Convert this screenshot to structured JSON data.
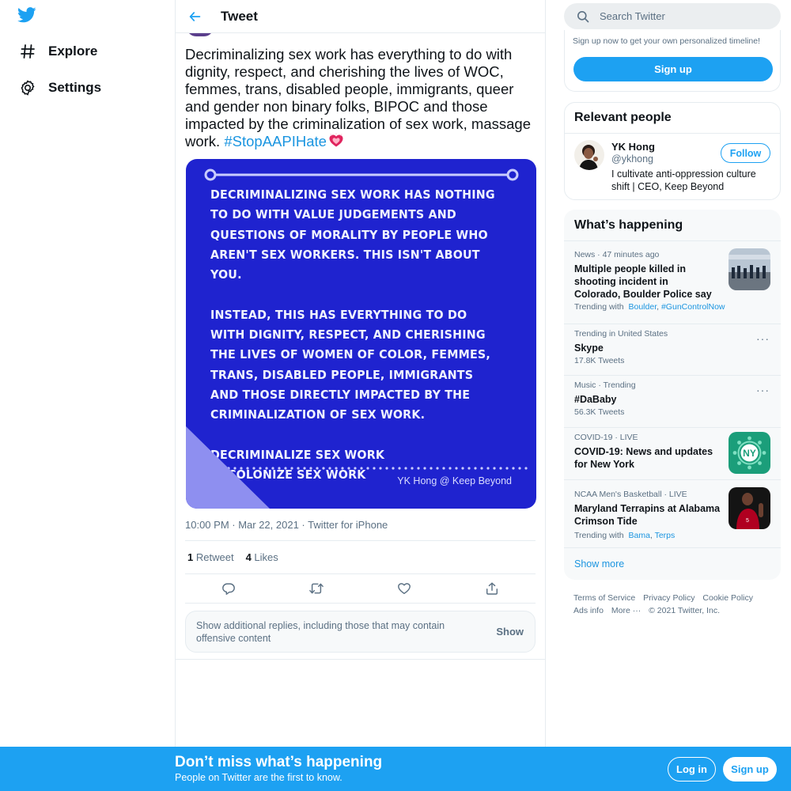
{
  "nav": {
    "logo_icon": "twitter-bird-icon",
    "items": [
      {
        "label": "Explore",
        "icon": "hashtag-icon"
      },
      {
        "label": "Settings",
        "icon": "gear-icon"
      }
    ]
  },
  "header": {
    "title": "Tweet",
    "back_icon": "arrow-left-icon"
  },
  "tweet": {
    "text": "Decriminalizing sex work has everything to do with dignity, respect, and cherishing the lives of WOC, femmes, trans, disabled people, immigrants, queer and gender non binary folks, BIPOC and those impacted by the criminalization of sex work, massage work.",
    "hashtag": "#StopAAPIHate",
    "emoji": "heart-emoji",
    "image": {
      "text": "Decriminalizing sex work has nothing to do with value judgements and questions of morality by people who aren't sex workers. This isn't about you.\n\nInstead, this has everything to do with dignity, respect, and cherishing the lives of Women of Color, femmes, trans, disabled people, immigrants and those directly impacted by the criminalization of sex work.\n\nDecriminalize sex work\nDecolonize sex work",
      "credit": "YK Hong @ Keep Beyond",
      "background": "#1f23cf"
    },
    "meta": "10:00 PM · Mar 22, 2021 · Twitter for iPhone",
    "retweets": {
      "count": "1",
      "label": "Retweet"
    },
    "likes": {
      "count": "4",
      "label": "Likes"
    },
    "actions": [
      "reply-icon",
      "retweet-icon",
      "like-icon",
      "share-icon"
    ]
  },
  "replies_notice": {
    "message": "Show additional replies, including those that may contain offensive content",
    "button": "Show"
  },
  "search": {
    "placeholder": "Search Twitter"
  },
  "signup_card": {
    "text": "Sign up now to get your own personalized timeline!",
    "button": "Sign up"
  },
  "relevant": {
    "title": "Relevant people",
    "person": {
      "name": "YK Hong",
      "handle": "@ykhong",
      "bio": "I cultivate anti-oppression culture shift | CEO, Keep Beyond",
      "follow": "Follow"
    }
  },
  "trends": {
    "title": "What’s happening",
    "items": [
      {
        "meta": "News · 47 minutes ago",
        "title": "Multiple people killed in shooting incident in Colorado, Boulder Police say",
        "sub_prefix": "Trending with",
        "links": [
          "Boulder",
          "#GunControlNow"
        ]
      },
      {
        "meta": "Trending in United States",
        "title": "Skype",
        "sub": "17.8K Tweets"
      },
      {
        "meta": "Music · Trending",
        "title": "#DaBaby",
        "sub": "56.3K Tweets"
      },
      {
        "meta": "COVID-19 · LIVE",
        "title": "COVID-19: News and updates for New York",
        "thumb_text": "NY"
      },
      {
        "meta": "NCAA Men's Basketball · LIVE",
        "title": "Maryland Terrapins at Alabama Crimson Tide",
        "sub_prefix": "Trending with",
        "links": [
          "Bama",
          "Terps"
        ]
      }
    ],
    "show_more": "Show more"
  },
  "footer": {
    "links": [
      "Terms of Service",
      "Privacy Policy",
      "Cookie Policy",
      "Ads info",
      "More ···",
      "© 2021 Twitter, Inc."
    ]
  },
  "bottom_bar": {
    "title": "Don’t miss what’s happening",
    "subtitle": "People on Twitter are the first to know.",
    "login": "Log in",
    "signup": "Sign up"
  },
  "colors": {
    "accent": "#1da1f2",
    "link": "#1b95e0",
    "muted": "#5b7083",
    "image_blue": "#1f23cf"
  }
}
